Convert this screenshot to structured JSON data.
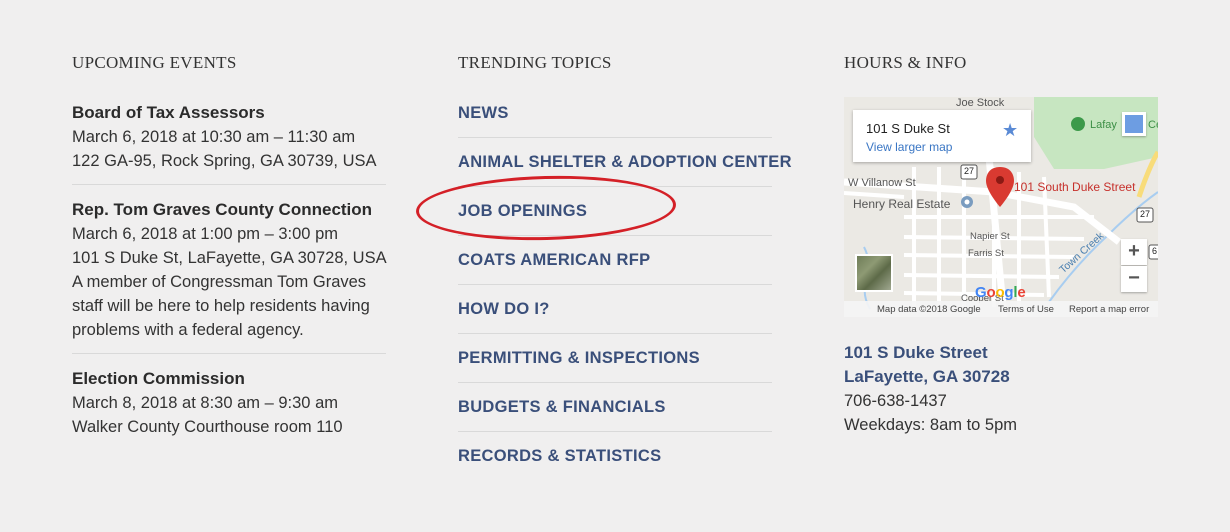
{
  "events": {
    "title": "UPCOMING EVENTS",
    "items": [
      {
        "title": "Board of Tax Assessors",
        "date": "March 6, 2018 at 10:30 am – 11:30 am",
        "location": "122 GA-95, Rock Spring, GA 30739, USA",
        "description": ""
      },
      {
        "title": "Rep. Tom Graves County Connection",
        "date": "March 6, 2018 at 1:00 pm – 3:00 pm",
        "location": "101 S Duke St, LaFayette, GA 30728, USA",
        "description": "A member of Congressman Tom Graves staff will be here to help residents having problems with a federal agency."
      },
      {
        "title": "Election Commission",
        "date": "March 8, 2018 at 8:30 am – 9:30 am",
        "location": "Walker County Courthouse room 110",
        "description": ""
      }
    ]
  },
  "topics": {
    "title": "TRENDING TOPICS",
    "items": [
      "NEWS",
      "ANIMAL SHELTER & ADOPTION CENTER",
      "JOB OPENINGS",
      "COATS AMERICAN RFP",
      "HOW DO I?",
      "PERMITTING & INSPECTIONS",
      "BUDGETS & FINANCIALS",
      "RECORDS & STATISTICS"
    ],
    "highlight_color": "#d42027"
  },
  "info": {
    "title": "HOURS & INFO",
    "map": {
      "card_address": "101 S Duke St",
      "card_link": "View larger map",
      "pin_label": "101 South Duke Street",
      "labels": {
        "joe_stock": "Joe Stock",
        "lafayette": "Lafay",
        "lafayette_edge": "Ce",
        "villanow": "W Villanow St",
        "henry": "Henry Real Estate",
        "napier": "Napier St",
        "farris": "Farris St",
        "town_creek": "Town Creek",
        "cooper": "Cooper St",
        "route_27a": "27",
        "route_27b": "27",
        "route_edge": "6"
      },
      "google": [
        "G",
        "o",
        "o",
        "g",
        "l",
        "e"
      ],
      "footer": {
        "data": "Map data ©2018 Google",
        "terms": "Terms of Use",
        "report": "Report a map error"
      },
      "zoom_in": "+",
      "zoom_out": "−",
      "star": "★"
    },
    "address_line1": "101 S Duke Street",
    "address_line2": "LaFayette, GA 30728",
    "phone": "706-638-1437",
    "hours": "Weekdays: 8am to 5pm"
  },
  "colors": {
    "link": "#3a4f7a",
    "background": "#f0efef",
    "pin": "#d93a31"
  }
}
